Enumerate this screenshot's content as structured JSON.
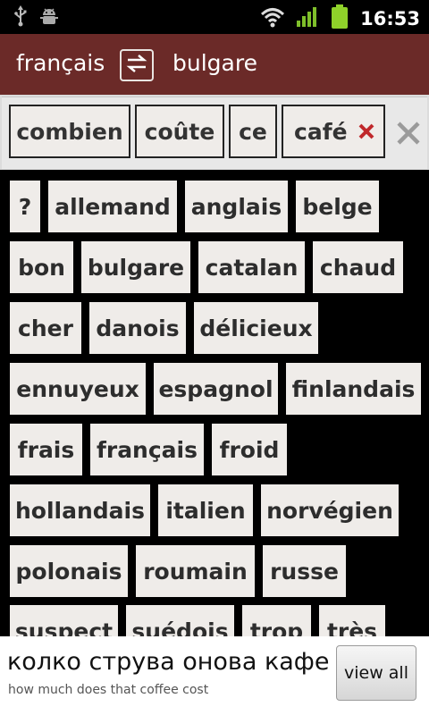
{
  "status_bar": {
    "time": "16:53",
    "icons": [
      "usb-icon",
      "android-debug-icon",
      "wifi-icon",
      "cell-signal-icon",
      "battery-icon"
    ]
  },
  "header": {
    "source_language": "français",
    "target_language": "bulgare",
    "swap_icon": "swap-arrows-icon",
    "background_color": "#6b2a28"
  },
  "phrase": {
    "words": [
      "combien",
      "coûte",
      "ce",
      "café"
    ],
    "remove_icon": "remove-x-icon",
    "remove_icon_color": "#c0282b",
    "clear_icon": "clear-x-icon"
  },
  "word_grid": {
    "rows": [
      [
        "?",
        "allemand",
        "anglais",
        "belge"
      ],
      [
        "bon",
        "bulgare",
        "catalan",
        "chaud"
      ],
      [
        "cher",
        "danois",
        "délicieux"
      ],
      [
        "ennuyeux",
        "espagnol",
        "finlandais"
      ],
      [
        "frais",
        "français",
        "froid"
      ],
      [
        "hollandais",
        "italien",
        "norvégien"
      ],
      [
        "polonais",
        "roumain",
        "russe"
      ],
      [
        "suspect",
        "suédois",
        "trop",
        "très"
      ]
    ]
  },
  "translation": {
    "text": "колко струва онова кафе",
    "gloss": "how much does that coffee cost",
    "view_all_label": "view all"
  }
}
